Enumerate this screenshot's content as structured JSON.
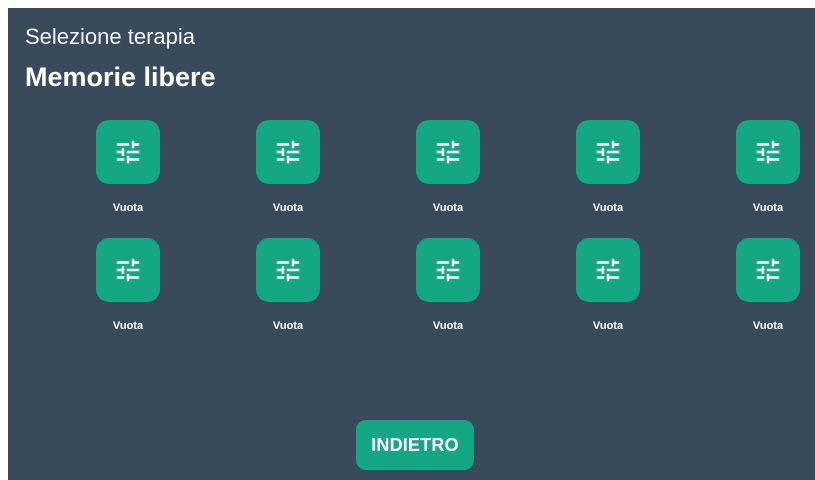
{
  "header": {
    "subtitle": "Selezione terapia",
    "title": "Memorie libere"
  },
  "slots": [
    {
      "label": "Vuota",
      "icon": "sliders-icon"
    },
    {
      "label": "Vuota",
      "icon": "sliders-icon"
    },
    {
      "label": "Vuota",
      "icon": "sliders-icon"
    },
    {
      "label": "Vuota",
      "icon": "sliders-icon"
    },
    {
      "label": "Vuota",
      "icon": "sliders-icon"
    },
    {
      "label": "Vuota",
      "icon": "sliders-icon"
    },
    {
      "label": "Vuota",
      "icon": "sliders-icon"
    },
    {
      "label": "Vuota",
      "icon": "sliders-icon"
    },
    {
      "label": "Vuota",
      "icon": "sliders-icon"
    },
    {
      "label": "Vuota",
      "icon": "sliders-icon"
    }
  ],
  "footer": {
    "back_label": "INDIETRO"
  },
  "colors": {
    "background": "#394a5b",
    "accent": "#14a784",
    "text": "#ffffff"
  }
}
